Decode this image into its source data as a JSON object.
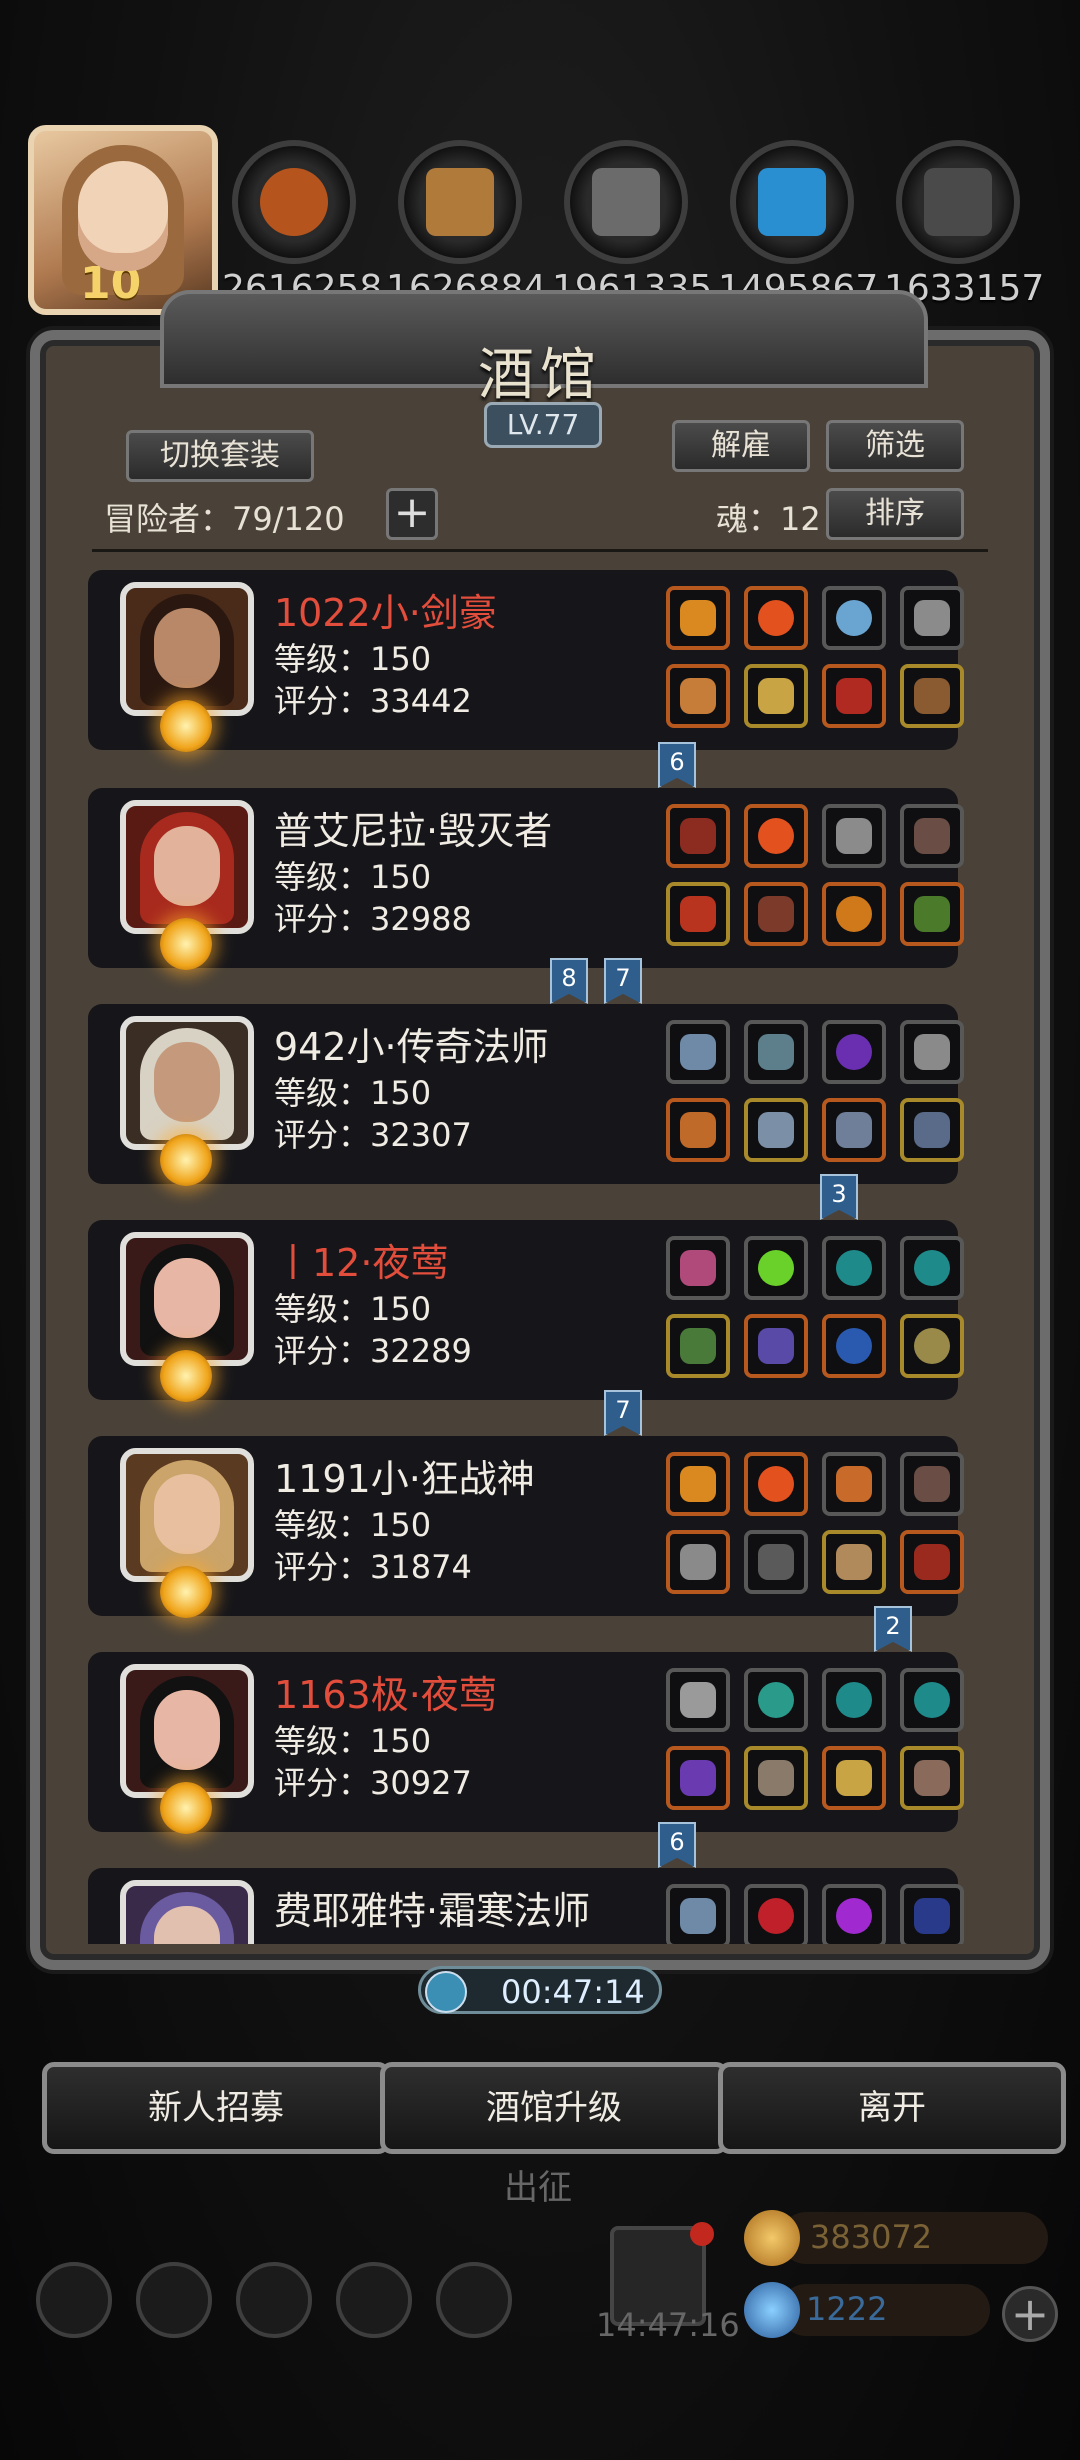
{
  "top": {
    "avatar_level": "10",
    "resources": [
      "2616258",
      "1626884",
      "1961335",
      "1495867",
      "1633157"
    ]
  },
  "panel": {
    "title": "酒馆",
    "level": "LV.77",
    "switch_set_label": "切换套装",
    "dismiss_label": "解雇",
    "filter_label": "筛选",
    "sort_label": "排序",
    "adventurers_label": "冒险者：79/120",
    "soul_label": "魂：12"
  },
  "heroes": [
    {
      "name": "1022小·剑豪",
      "level": "等级：150",
      "score": "评分：33442"
    },
    {
      "name": "普艾尼拉·毁灭者",
      "level": "等级：150",
      "score": "评分：32988"
    },
    {
      "name": "942小·传奇法师",
      "level": "等级：150",
      "score": "评分：32307"
    },
    {
      "name": "丨12·夜莺",
      "level": "等级：150",
      "score": "评分：32289"
    },
    {
      "name": "1191小·狂战神",
      "level": "等级：150",
      "score": "评分：31874"
    },
    {
      "name": "1163极·夜莺",
      "level": "等级：150",
      "score": "评分：30927"
    },
    {
      "name": "费耶雅特·霜寒法师"
    }
  ],
  "ribbons": [
    "6",
    "8",
    "7",
    "3",
    "7",
    "2",
    "6"
  ],
  "timer": "00:47:14",
  "bottom": {
    "recruit_label": "新人招募",
    "upgrade_label": "酒馆升级",
    "leave_label": "离开",
    "expedition_label": "出征",
    "gift_timer": "14:47:16",
    "gold": "383072",
    "gems": "1222"
  },
  "colors": {
    "red_name": "#e34d3c",
    "panel_bg": "#4a4238",
    "ribbon": "#2f5e8c"
  }
}
